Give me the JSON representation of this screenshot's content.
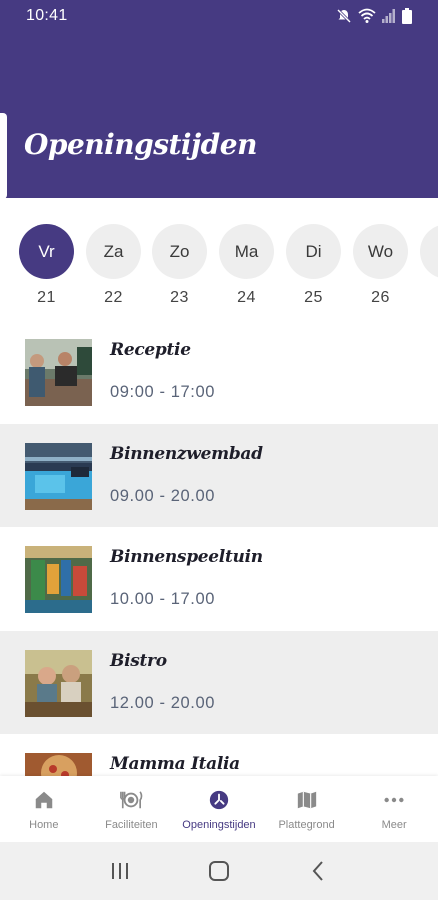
{
  "status_bar": {
    "time": "10:41"
  },
  "header": {
    "title": "Openingstijden"
  },
  "days": [
    {
      "label": "Vr",
      "num": "21",
      "active": true
    },
    {
      "label": "Za",
      "num": "22",
      "active": false
    },
    {
      "label": "Zo",
      "num": "23",
      "active": false
    },
    {
      "label": "Ma",
      "num": "24",
      "active": false
    },
    {
      "label": "Di",
      "num": "25",
      "active": false
    },
    {
      "label": "Wo",
      "num": "26",
      "active": false
    }
  ],
  "facilities": [
    {
      "name": "Receptie",
      "hours": "09:00 - 17:00"
    },
    {
      "name": "Binnenzwembad",
      "hours": "09.00 - 20.00"
    },
    {
      "name": "Binnenspeeltuin",
      "hours": "10.00 - 17.00"
    },
    {
      "name": "Bistro",
      "hours": "12.00 - 20.00"
    },
    {
      "name": "Mamma Italia",
      "hours": ""
    }
  ],
  "tabs": {
    "home": "Home",
    "faciliteiten": "Faciliteiten",
    "openingstijden": "Openingstijden",
    "plattegrond": "Plattegrond",
    "meer": "Meer"
  },
  "colors": {
    "brand": "#463a82",
    "shaded_row": "#eeeeee",
    "hours_text": "#5a6478"
  },
  "icons": [
    "mute-icon",
    "wifi-icon",
    "signal-icon",
    "battery-icon",
    "home-icon",
    "cutlery-icon",
    "clock-icon",
    "map-icon",
    "more-dots-icon",
    "recent-apps-icon",
    "home-nav-icon",
    "back-icon"
  ]
}
